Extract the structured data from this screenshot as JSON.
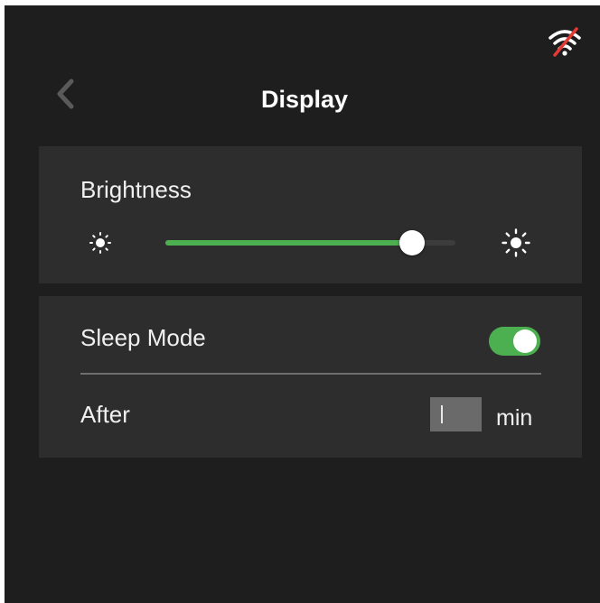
{
  "header": {
    "title": "Display",
    "back_icon": "chevron-left-icon",
    "status_icon": "wifi-off-icon"
  },
  "brightness": {
    "label": "Brightness",
    "level_percent": 85,
    "min_icon": "sun-small-icon",
    "max_icon": "sun-large-icon"
  },
  "sleep": {
    "label": "Sleep Mode",
    "enabled": true,
    "after_label": "After",
    "after_value": "",
    "unit": "min"
  },
  "colors": {
    "background": "#1e1e1e",
    "card": "#2d2d2d",
    "accent": "#4caf50",
    "wifi_slash": "#e53935",
    "input_bg": "#6a6a6a"
  }
}
